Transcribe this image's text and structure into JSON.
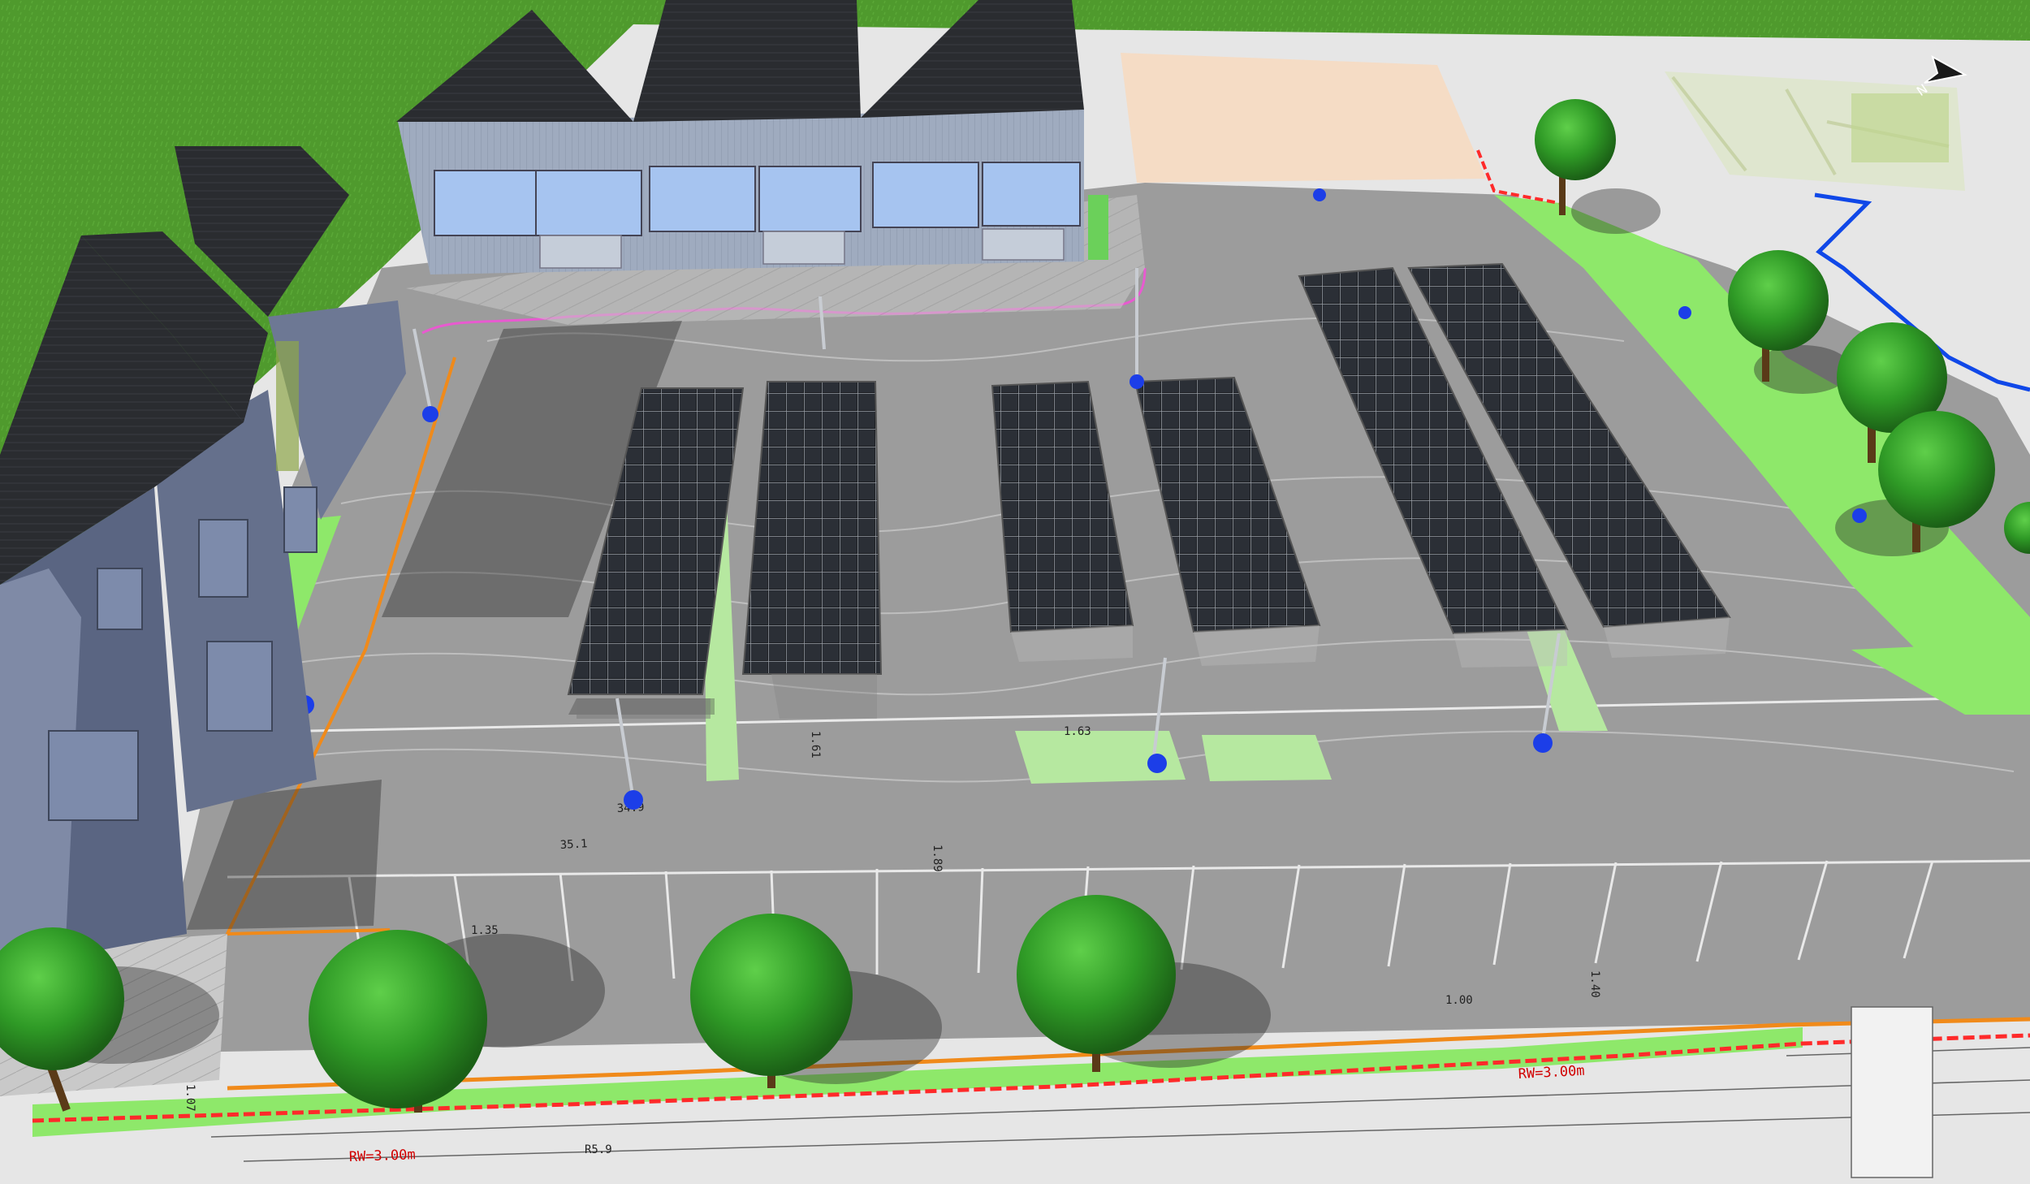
{
  "viewer": {
    "compass": {
      "label": "N"
    }
  },
  "colors": {
    "grass": "#4f9a2d",
    "pavement": "#9a9a9a",
    "plan_paper": "#e9e9e9",
    "green_strip": "#8ee86a",
    "boundary_red": "#ff2a2a",
    "edge_orange": "#f08a1a",
    "pink_curb": "#e85ad0",
    "blue_line": "#1048e8",
    "solar_panel": "#1e2024",
    "building_left": "#5d6a86",
    "building_right": "#a9b4c6",
    "roof": "#2a2c30",
    "tree": "#2d8c22",
    "shadow": "rgba(40,40,40,0.45)"
  },
  "annotations": {
    "spot_heights": [
      "34.9",
      "35.1",
      "1.63",
      "1.89",
      "1.61",
      "1.35",
      "1.40",
      "1.07",
      "1.00"
    ],
    "street_labels": [
      "RW=3.00m",
      "RW=3.00m",
      "R5.9"
    ]
  }
}
